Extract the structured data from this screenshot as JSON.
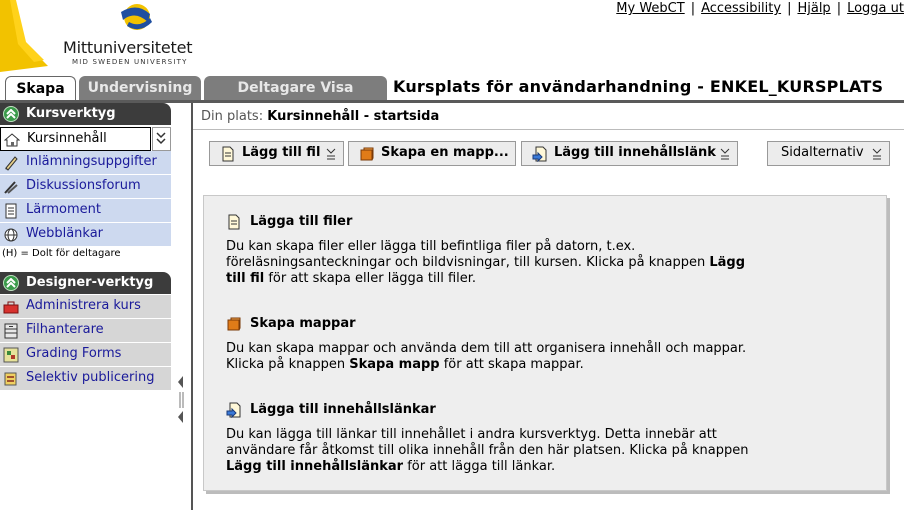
{
  "header": {
    "logo_name": "Mittuniversitetet",
    "logo_sub": "MID SWEDEN UNIVERSITY",
    "links": [
      "My WebCT",
      "Accessibility",
      "Hjälp",
      "Logga ut"
    ],
    "link_separator": "|"
  },
  "tabs": [
    {
      "label": "Skapa",
      "active": true
    },
    {
      "label": "Undervisning",
      "active": false
    },
    {
      "label": "Deltagare Visa",
      "active": false
    }
  ],
  "course_title": "Kursplats för användarhandning - ENKEL_KURSPLATS",
  "sidebar": {
    "kursverktyg_title": "Kursverktyg",
    "kursverktyg_items": [
      {
        "label": "Kursinnehåll",
        "icon": "house-icon",
        "active": true
      },
      {
        "label": "Inlämningsuppgifter",
        "icon": "pen-icon"
      },
      {
        "label": "Diskussionsforum",
        "icon": "pins-icon"
      },
      {
        "label": "Lärmoment",
        "icon": "document-icon"
      },
      {
        "label": "Webblänkar",
        "icon": "globe-icon"
      }
    ],
    "hidden_note": "(H) = Dolt för deltagare",
    "designer_title": "Designer-verktyg",
    "designer_items": [
      {
        "label": "Administrera kurs",
        "icon": "toolbox-icon"
      },
      {
        "label": "Filhanterare",
        "icon": "cabinet-icon"
      },
      {
        "label": "Grading Forms",
        "icon": "grid-form-icon"
      },
      {
        "label": "Selektiv publicering",
        "icon": "publish-icon"
      }
    ]
  },
  "breadcrumb": {
    "label": "Din plats:",
    "current": "Kursinnehåll - startsida"
  },
  "toolbar": {
    "add_file": "Lägg till fil",
    "create_folder": "Skapa en mapp...",
    "add_link": "Lägg till innehållslänk",
    "page_options": "Sidalternativ"
  },
  "info": {
    "s1_title": "Lägga till filer",
    "s1_text_a": "Du kan skapa filer eller lägga till befintliga filer på datorn, t.ex. föreläsningsanteckningar och bildvisningar, till kursen. Klicka på knappen ",
    "s1_bold": "Lägg till fil",
    "s1_text_b": " för att skapa eller lägga till filer.",
    "s2_title": "Skapa mappar",
    "s2_text_a": "Du kan skapa mappar och använda dem till att organisera innehåll och mappar. Klicka på knappen ",
    "s2_bold": "Skapa mapp",
    "s2_text_b": " för att skapa mappar.",
    "s3_title": "Lägga till innehållslänkar",
    "s3_text_a": "Du kan lägga till länkar till innehållet i andra kursverktyg. Detta innebär att användare får åtkomst till olika innehåll från den här platsen. Klicka på knappen ",
    "s3_bold": "Lägg till innehållslänkar",
    "s3_text_b": " för att lägga till länkar."
  },
  "colors": {
    "nav_blue": "#cdd9ef",
    "nav_gray": "#d6d6d6",
    "section_head": "#3c3c3c",
    "inactive_tab": "#7d7d7d",
    "link_text": "#1a1a9a"
  }
}
